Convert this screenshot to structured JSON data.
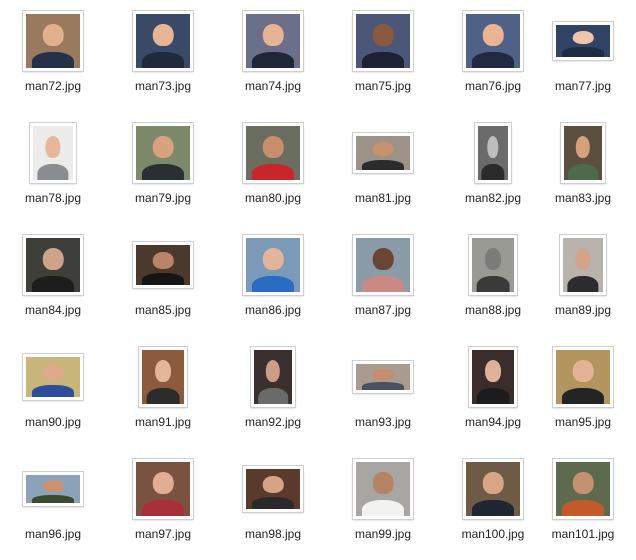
{
  "files": [
    {
      "name": "man72.jpg",
      "bg": "#9a7a5c",
      "skin": "#e2b08f",
      "cloth": "#23324a"
    },
    {
      "name": "man73.jpg",
      "bg": "#3a4a66",
      "skin": "#e7b596",
      "cloth": "#1f2a3c"
    },
    {
      "name": "man74.jpg",
      "bg": "#6b6f8a",
      "skin": "#e6b394",
      "cloth": "#1d2738"
    },
    {
      "name": "man75.jpg",
      "bg": "#4b5779",
      "skin": "#8a5a3e",
      "cloth": "#1c2233"
    },
    {
      "name": "man76.jpg",
      "bg": "#4f6187",
      "skin": "#e9b48f",
      "cloth": "#202a40"
    },
    {
      "name": "man77.jpg",
      "bg": "#324466",
      "skin": "#efc6ab",
      "cloth": "#1e2b44"
    },
    {
      "name": "man78.jpg",
      "bg": "#ececec",
      "skin": "#e8b79a",
      "cloth": "#8a8d91"
    },
    {
      "name": "man79.jpg",
      "bg": "#7c8a6a",
      "skin": "#d8a27f",
      "cloth": "#2b2f33"
    },
    {
      "name": "man80.jpg",
      "bg": "#6a6e60",
      "skin": "#c98f6c",
      "cloth": "#c9252a"
    },
    {
      "name": "man81.jpg",
      "bg": "#9c9386",
      "skin": "#c9926f",
      "cloth": "#2b2b2b"
    },
    {
      "name": "man82.jpg",
      "bg": "#6b6b6b",
      "skin": "#bdbdbd",
      "cloth": "#2a2a2a"
    },
    {
      "name": "man83.jpg",
      "bg": "#5b4f3f",
      "skin": "#d7a07c",
      "cloth": "#4d6a4b"
    },
    {
      "name": "man84.jpg",
      "bg": "#3e3f3a",
      "skin": "#cfa389",
      "cloth": "#1d1d1d"
    },
    {
      "name": "man85.jpg",
      "bg": "#4a3a2e",
      "skin": "#b98566",
      "cloth": "#151515"
    },
    {
      "name": "man86.jpg",
      "bg": "#7b9ab8",
      "skin": "#e2b49c",
      "cloth": "#2a6cc4"
    },
    {
      "name": "man87.jpg",
      "bg": "#8a9ca8",
      "skin": "#6b4533",
      "cloth": "#c98a86"
    },
    {
      "name": "man88.jpg",
      "bg": "#9a9a94",
      "skin": "#7b7b78",
      "cloth": "#3a3a38"
    },
    {
      "name": "man89.jpg",
      "bg": "#b9b3ad",
      "skin": "#d3a48a",
      "cloth": "#2c2c2e"
    },
    {
      "name": "man90.jpg",
      "bg": "#c7b57a",
      "skin": "#dca98a",
      "cloth": "#2d4f9b"
    },
    {
      "name": "man91.jpg",
      "bg": "#8c5a3d",
      "skin": "#e4b699",
      "cloth": "#2c2c2c"
    },
    {
      "name": "man92.jpg",
      "bg": "#3a3030",
      "skin": "#cf9d86",
      "cloth": "#6a6a6a"
    },
    {
      "name": "man93.jpg",
      "bg": "#a99b8d",
      "skin": "#c48e6c",
      "cloth": "#4a5060"
    },
    {
      "name": "man94.jpg",
      "bg": "#3b2e2a",
      "skin": "#e1b09a",
      "cloth": "#1c1c1e"
    },
    {
      "name": "man95.jpg",
      "bg": "#b3955f",
      "skin": "#e3b398",
      "cloth": "#222426"
    },
    {
      "name": "man96.jpg",
      "bg": "#8aa3b8",
      "skin": "#c99373",
      "cloth": "#3a4b2e"
    },
    {
      "name": "man97.jpg",
      "bg": "#7a5240",
      "skin": "#e2ad92",
      "cloth": "#a8303a"
    },
    {
      "name": "man98.jpg",
      "bg": "#5a3a2a",
      "skin": "#d6a385",
      "cloth": "#2a2a2a"
    },
    {
      "name": "man99.jpg",
      "bg": "#a8a6a2",
      "skin": "#b58462",
      "cloth": "#f2f2f0"
    },
    {
      "name": "man100.jpg",
      "bg": "#6e5b45",
      "skin": "#d9a685",
      "cloth": "#1e2533"
    },
    {
      "name": "man101.jpg",
      "bg": "#5e6a4d",
      "skin": "#c49273",
      "cloth": "#c25a2a"
    }
  ]
}
